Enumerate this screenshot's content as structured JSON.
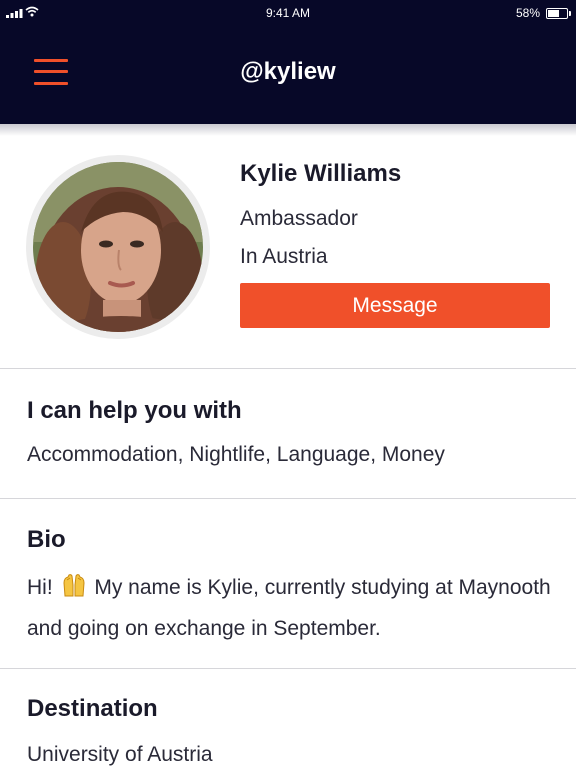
{
  "status_bar": {
    "time": "9:41 AM",
    "battery": "58%"
  },
  "header": {
    "title": "@kyliew",
    "menu_icon": "hamburger-menu-icon"
  },
  "profile": {
    "name": "Kylie Williams",
    "role": "Ambassador",
    "location": "In Austria",
    "message_label": "Message"
  },
  "help": {
    "title": "I can help you with",
    "text": "Accommodation, Nightlife, Language, Money"
  },
  "bio": {
    "title": "Bio",
    "text_before": "Hi!",
    "emoji": "raised-hands-emoji-icon",
    "text_after": "My name is Kylie, currently studying at Maynooth and going on exchange in September."
  },
  "destination": {
    "title": "Destination",
    "text": "University of Austria"
  },
  "colors": {
    "header_bg": "#070828",
    "accent": "#f0502a",
    "divider": "#d6d6da"
  }
}
